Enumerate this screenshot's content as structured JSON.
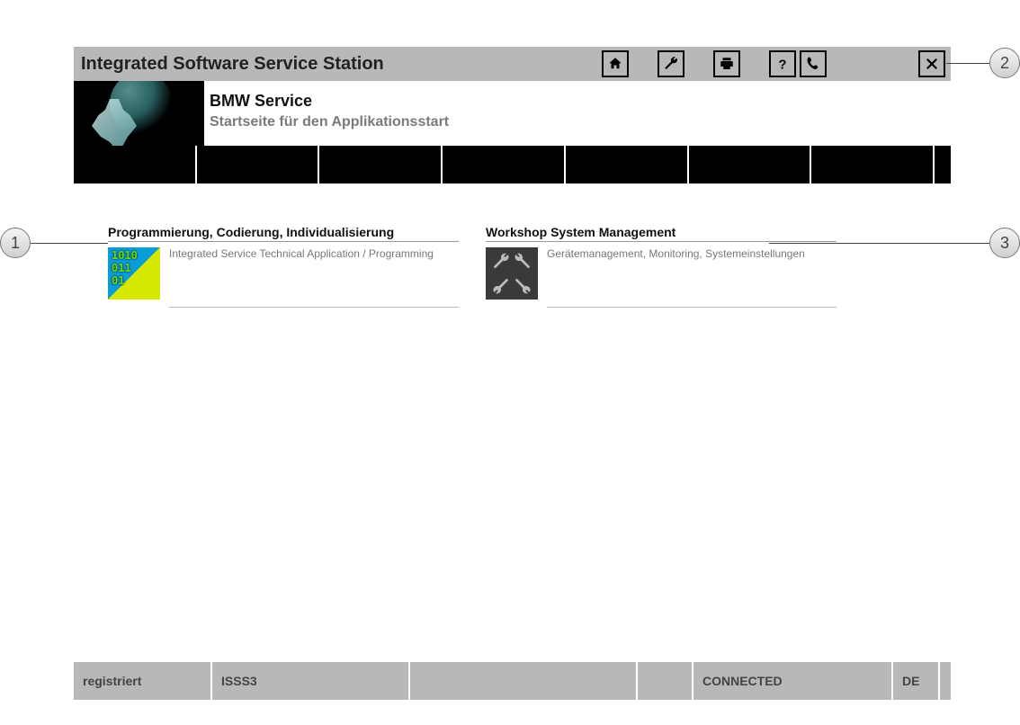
{
  "header": {
    "title": "Integrated Software Service Station",
    "icons": {
      "home": "home-icon",
      "tools": "wrench-icon",
      "print": "printer-icon",
      "help": "help-icon",
      "phone": "phone-icon",
      "close": "close-icon"
    }
  },
  "sub_header": {
    "title": "BMW Service",
    "subtitle": "Startseite für den Applikationsstart"
  },
  "apps": [
    {
      "title": "Programmierung, Codierung, Individualisierung",
      "desc": "Integrated Service Technical Application / Programming"
    },
    {
      "title": "Workshop System Management",
      "desc": "Gerätemanagement, Monitoring, Systemeinstellungen"
    }
  ],
  "status_bar": {
    "registration": "registriert",
    "station": "ISSS3",
    "connection": "CONNECTED",
    "lang": "DE"
  },
  "callouts": {
    "c1": "1",
    "c2": "2",
    "c3": "3"
  }
}
